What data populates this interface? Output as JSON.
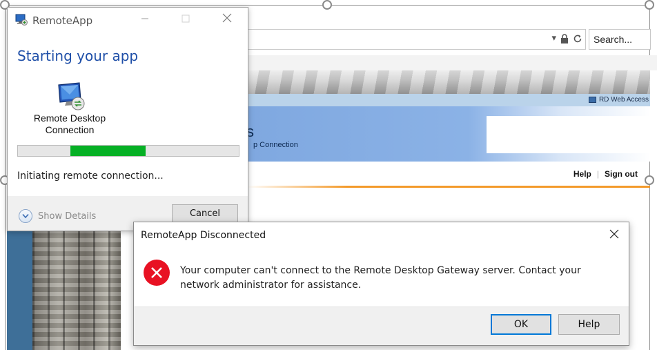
{
  "browser": {
    "search_placeholder": "Search...",
    "rdweb_label": "RD Web Access",
    "banner_title": "s",
    "banner_subtitle": "p Connection",
    "nav": {
      "help": "Help",
      "sign_out": "Sign out"
    }
  },
  "remoteapp_window": {
    "title": "RemoteApp",
    "heading": "Starting your app",
    "app_name": "Remote Desktop\nConnection",
    "progress_fraction": 0.34,
    "status": "Initiating remote connection...",
    "show_details": "Show Details",
    "cancel": "Cancel"
  },
  "dialog": {
    "title": "RemoteApp Disconnected",
    "message": "Your computer can't connect to the Remote Desktop Gateway server. Contact your network administrator for assistance.",
    "ok": "OK",
    "help": "Help"
  },
  "colors": {
    "heading_blue": "#1f4fa8",
    "progress_green": "#06b025",
    "error_red": "#e81123",
    "ok_border": "#0078d7"
  },
  "icons": [
    "remoteapp-icon",
    "remote-desktop-connection-icon",
    "chevron-down-icon",
    "error-icon",
    "close-icon",
    "minimize-icon",
    "maximize-icon",
    "lock-icon",
    "refresh-icon",
    "dropdown-icon"
  ]
}
